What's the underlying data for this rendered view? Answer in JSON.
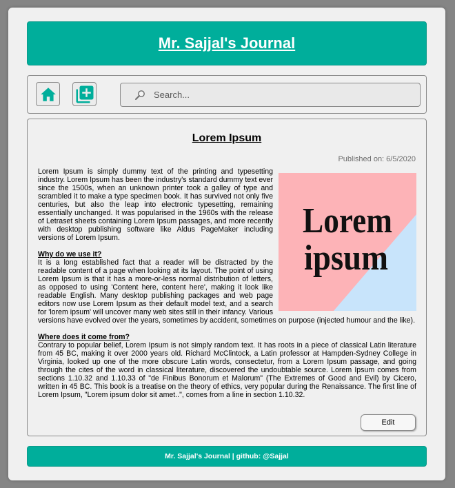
{
  "header": {
    "title": "Mr. Sajjal's Journal"
  },
  "toolbar": {
    "home_icon": "home-icon",
    "add_icon": "add-note-icon",
    "search_placeholder": "Search..."
  },
  "article": {
    "title": "Lorem Ipsum",
    "published": "Published on: 6/5/2020",
    "image": {
      "line1": "Lorem",
      "line2": "ipsum",
      "colors": {
        "pink": "#fdb3b7",
        "blue": "#c8e4fb"
      }
    },
    "intro": "Lorem Ipsum is simply dummy text of the printing and typesetting industry. Lorem Ipsum has been the industry's standard dummy text ever since the 1500s, when an unknown printer took a galley of type and scrambled it to make a type specimen book. It has survived not only five centuries, but also the leap into electronic typesetting, remaining essentially unchanged. It was popularised in the 1960s with the release of Letraset sheets containing Lorem Ipsum passages, and more recently with desktop publishing software like Aldus PageMaker including versions of Lorem Ipsum.",
    "section1_heading": "Why do we use it?",
    "section1_text": "It is a long established fact that a reader will be distracted by the readable content of a page when looking at its layout. The point of using Lorem Ipsum is that it has a more-or-less normal distribution of letters, as opposed to using 'Content here, content here', making it look like readable English. Many desktop publishing packages and web page editors now use Lorem Ipsum as their default model text, and a search for 'lorem ipsum' will uncover many web sites still in their infancy. Various versions have evolved over the years, sometimes by accident, sometimes on purpose (injected humour and the like).",
    "section2_heading": "Where does it come from?",
    "section2_text": "Contrary to popular belief, Lorem Ipsum is not simply random text. It has roots in a piece of classical Latin literature from 45 BC, making it over 2000 years old. Richard McClintock, a Latin professor at Hampden-Sydney College in Virginia, looked up one of the more obscure Latin words, consectetur, from a Lorem Ipsum passage, and going through the cites of the word in classical literature, discovered the undoubtable source. Lorem Ipsum comes from sections 1.10.32 and 1.10.33 of \"de Finibus Bonorum et Malorum\" (The Extremes of Good and Evil) by Cicero, written in 45 BC. This book is a treatise on the theory of ethics, very popular during the Renaissance. The first line of Lorem Ipsum, \"Lorem ipsum dolor sit amet..\", comes from a line in section 1.10.32.",
    "edit_label": "Edit"
  },
  "footer": {
    "text": "Mr. Sajjal's Journal | github: @Sajjal"
  },
  "colors": {
    "accent": "#00ae9b",
    "background": "#858585",
    "panel": "#f0f0f0"
  }
}
